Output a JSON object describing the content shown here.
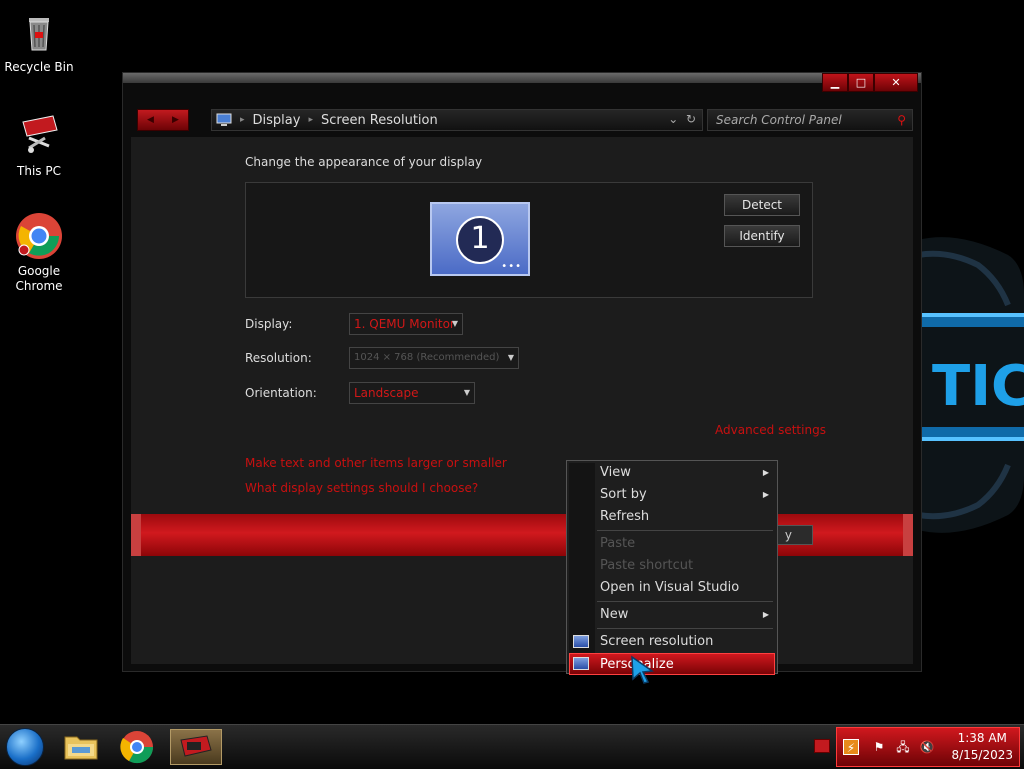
{
  "desktop": {
    "icons": [
      {
        "label": "Recycle Bin"
      },
      {
        "label": "This PC"
      },
      {
        "label": "Google Chrome"
      }
    ]
  },
  "window": {
    "address": {
      "crumb1": "Display",
      "crumb2": "Screen Resolution"
    },
    "search": {
      "placeholder": "Search Control Panel"
    },
    "heading": "Change the appearance of your display",
    "monitor_number": "1",
    "buttons": {
      "detect": "Detect",
      "identify": "Identify",
      "apply_partial": "y"
    },
    "fields": {
      "display_label": "Display:",
      "display_value": "1. QEMU Monitor",
      "resolution_label": "Resolution:",
      "resolution_value": "1024 × 768 (Recommended)",
      "orientation_label": "Orientation:",
      "orientation_value": "Landscape"
    },
    "links": {
      "advanced": "Advanced settings",
      "text_size": "Make text and other items larger or smaller",
      "which_settings": "What display settings should I choose?"
    }
  },
  "context_menu": {
    "items": [
      {
        "label": "View",
        "submenu": true,
        "disabled": false
      },
      {
        "label": "Sort by",
        "submenu": true,
        "disabled": false
      },
      {
        "label": "Refresh",
        "submenu": false,
        "disabled": false
      },
      {
        "label": "Paste",
        "submenu": false,
        "disabled": true
      },
      {
        "label": "Paste shortcut",
        "submenu": false,
        "disabled": true
      },
      {
        "label": "Open in Visual Studio",
        "submenu": false,
        "disabled": false
      },
      {
        "label": "New",
        "submenu": true,
        "disabled": false
      },
      {
        "label": "Screen resolution",
        "submenu": false,
        "disabled": false
      },
      {
        "label": "Personalize",
        "submenu": false,
        "disabled": false,
        "highlighted": true
      }
    ]
  },
  "taskbar": {
    "clock": {
      "time": "1:38 AM",
      "date": "8/15/2023"
    }
  },
  "colors": {
    "accent": "#d1191e",
    "link": "#c81010",
    "background": "#000000"
  }
}
